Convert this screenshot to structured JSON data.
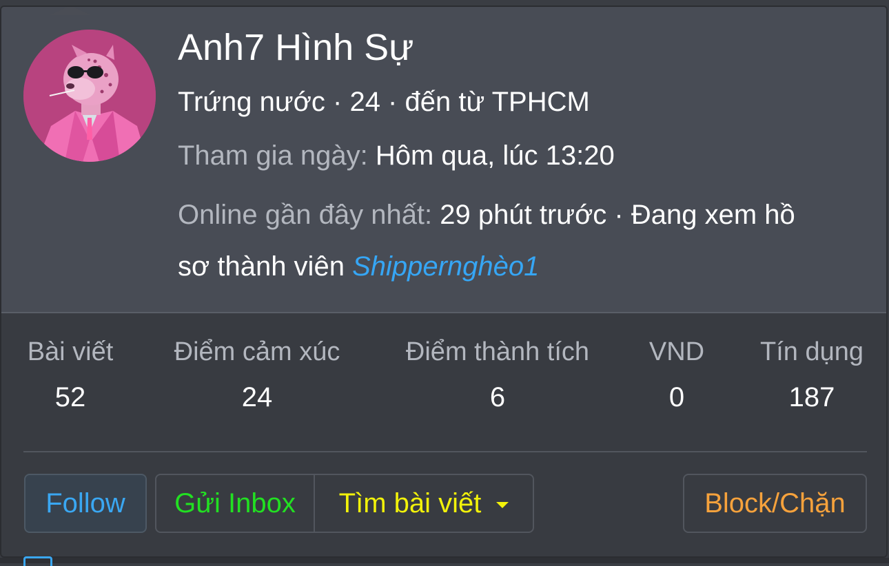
{
  "profile": {
    "username": "Anh7 Hình Sự",
    "rank_line": "Trứng nước · 24 · đến từ TPHCM",
    "joined_label": "Tham gia ngày:",
    "joined_value": "Hôm qua, lúc 13:20",
    "online_label": "Online gần đây nhất:",
    "online_value_line1": "29 phút trước · Đang xem hồ",
    "online_value_line2": "sơ thành viên",
    "online_link": "Shippernghèo1"
  },
  "stats": [
    {
      "label": "Bài viết",
      "value": "52"
    },
    {
      "label": "Điểm cảm xúc",
      "value": "24"
    },
    {
      "label": "Điểm thành tích",
      "value": "6"
    },
    {
      "label": "VND",
      "value": "0"
    },
    {
      "label": "Tín dụng",
      "value": "187"
    }
  ],
  "buttons": {
    "follow": "Follow",
    "inbox": "Gửi Inbox",
    "find_posts": "Tìm bài viết",
    "block": "Block/Chặn"
  },
  "colors": {
    "follow": "#3aa7f2",
    "inbox": "#22e022",
    "find_posts": "#f2f20a",
    "block": "#f6a23c",
    "link": "#36a6f5"
  },
  "icons": {
    "avatar": "pink-leopard-avatar",
    "dropdown": "caret-down-icon"
  }
}
